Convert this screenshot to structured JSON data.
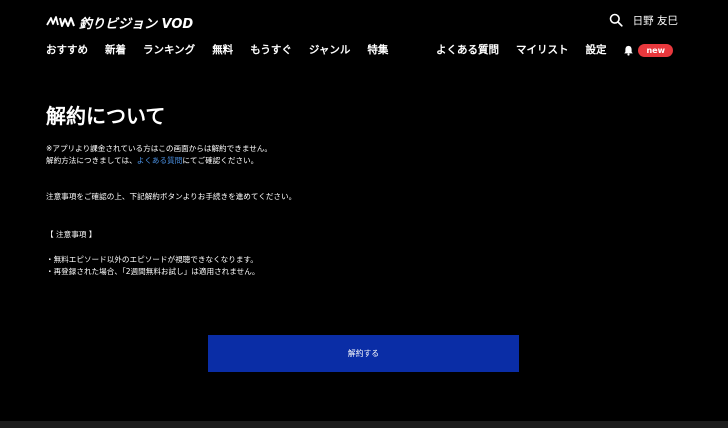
{
  "header": {
    "logo_text": "釣りビジョン VOD",
    "user_name": "日野 友巳",
    "nav_items": [
      "おすすめ",
      "新着",
      "ランキング",
      "無料",
      "もうすぐ",
      "ジャンル",
      "特集"
    ],
    "right_items": [
      "よくある質問",
      "マイリスト",
      "設定"
    ],
    "badge": "new"
  },
  "main": {
    "title": "解約について",
    "note_app": "※アプリより課金されている方はこの画面からは解約できません。",
    "note_method_prefix": "解約方法につきましては、",
    "note_method_link": "よくある質問",
    "note_method_suffix": "にてご確認ください。",
    "instruction": "注意事項をご確認の上、下記解約ボタンよりお手続きを進めてください。",
    "caution_heading": "【 注意事項 】",
    "caution_items": [
      "・無料エピソード以外のエピソードが視聴できなくなります。",
      "・再登録された場合、「2週間無料お試し」は適用されません。"
    ],
    "button_label": "解約する"
  },
  "colors": {
    "background": "#000000",
    "button": "#0a2da6",
    "link": "#4a90e2",
    "badge": "#e8383d"
  },
  "icons": [
    "brand-logo-icon",
    "search-icon",
    "bell-icon"
  ]
}
